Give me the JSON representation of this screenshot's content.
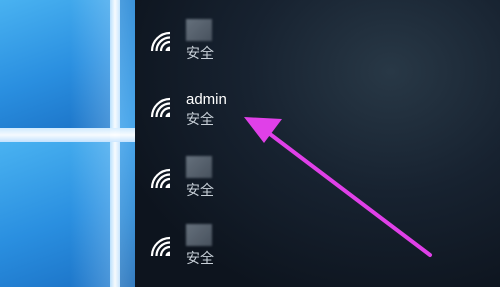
{
  "networks": [
    {
      "name": "",
      "status": "安全",
      "name_obscured": true
    },
    {
      "name": "admin",
      "status": "安全",
      "name_obscured": false
    },
    {
      "name": "",
      "status": "安全",
      "name_obscured": true
    },
    {
      "name": "",
      "status": "安全",
      "name_obscured": true
    }
  ],
  "icons": {
    "network": "wifi-signal-icon"
  },
  "colors": {
    "annotation_arrow": "#e040e8",
    "text": "#ffffff",
    "status_text": "#c8d0d8"
  }
}
